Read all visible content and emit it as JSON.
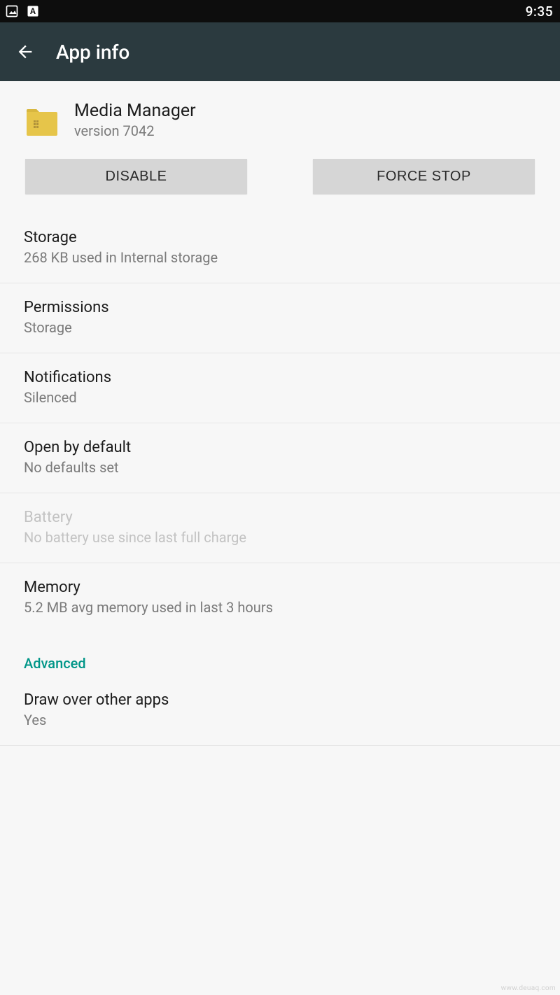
{
  "statusbar": {
    "time": "9:35"
  },
  "header": {
    "title": "App info"
  },
  "app": {
    "name": "Media Manager",
    "version_line": "version 7042"
  },
  "buttons": {
    "disable": "DISABLE",
    "force_stop": "FORCE STOP"
  },
  "sections": {
    "storage": {
      "title": "Storage",
      "sub": "268 KB used in Internal storage"
    },
    "permissions": {
      "title": "Permissions",
      "sub": "Storage"
    },
    "notifications": {
      "title": "Notifications",
      "sub": "Silenced"
    },
    "open_by_default": {
      "title": "Open by default",
      "sub": "No defaults set"
    },
    "battery": {
      "title": "Battery",
      "sub": "No battery use since last full charge"
    },
    "memory": {
      "title": "Memory",
      "sub": "5.2 MB avg memory used in last 3 hours"
    },
    "advanced_label": "Advanced",
    "draw_over": {
      "title": "Draw over other apps",
      "sub": "Yes"
    }
  },
  "watermark": "www.deuaq.com"
}
